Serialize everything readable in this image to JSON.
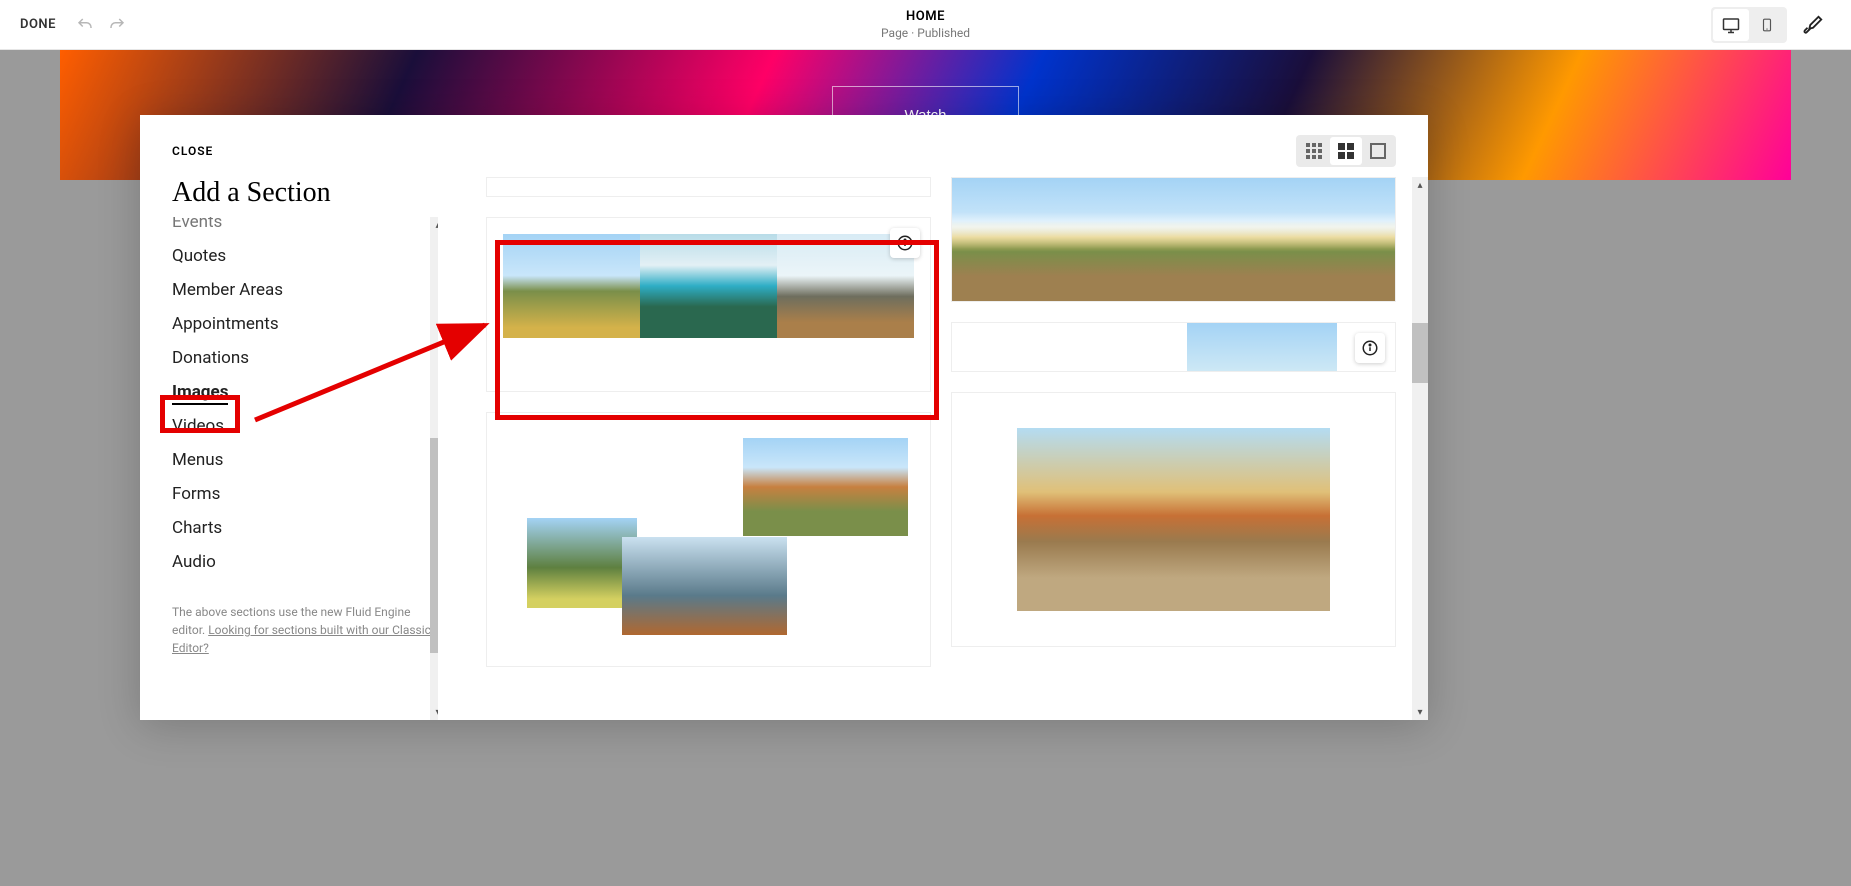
{
  "topbar": {
    "done": "DONE",
    "title": "HOME",
    "subtitle": "Page · Published"
  },
  "preview": {
    "watch_label": "Watch"
  },
  "modal": {
    "close_label": "CLOSE",
    "title": "Add a Section",
    "categories": [
      {
        "label": "Events",
        "partial": true
      },
      {
        "label": "Quotes"
      },
      {
        "label": "Member Areas"
      },
      {
        "label": "Appointments"
      },
      {
        "label": "Donations"
      },
      {
        "label": "Images",
        "active": true
      },
      {
        "label": "Videos"
      },
      {
        "label": "Menus"
      },
      {
        "label": "Forms"
      },
      {
        "label": "Charts"
      },
      {
        "label": "Audio"
      }
    ],
    "footer_text": "The above sections use the new Fluid Engine editor. ",
    "footer_link": "Looking for sections built with our Classic Editor?"
  }
}
